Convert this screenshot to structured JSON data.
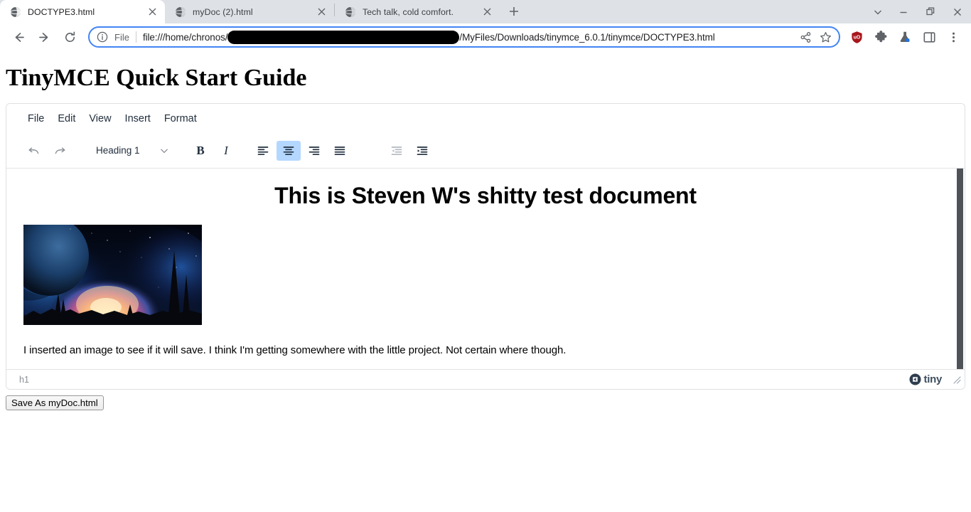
{
  "browser": {
    "tabs": [
      {
        "title": "DOCTYPE3.html",
        "active": true,
        "favicon": "globe-icon"
      },
      {
        "title": "myDoc (2).html",
        "active": false,
        "favicon": "globe-icon"
      },
      {
        "title": "Tech talk, cold comfort.",
        "active": false,
        "favicon": "globe-icon"
      }
    ],
    "new_tab_label": "+",
    "window_controls": {
      "tab_search": "tab-search-icon",
      "minimize": "minimize-icon",
      "maximize": "restore-icon",
      "close": "close-icon"
    },
    "nav": {
      "back": "back-arrow-icon",
      "forward": "forward-arrow-icon",
      "reload": "reload-icon"
    },
    "omnibox": {
      "info_icon": "info-circle-icon",
      "scheme_label": "File",
      "url_prefix": "file:///home/chronos/",
      "url_suffix": "/MyFiles/Downloads/tinymce_6.0.1/tinymce/DOCTYPE3.html",
      "redacted": true,
      "share_icon": "share-icon",
      "bookmark_icon": "star-icon"
    },
    "extensions": [
      {
        "name": "ublock-origin-icon",
        "color": "#a8161c"
      },
      {
        "name": "puzzle-extensions-icon",
        "color": "#5f6368"
      },
      {
        "name": "lab-flask-icon",
        "color": "#5f6368"
      },
      {
        "name": "side-panel-icon",
        "color": "#5f6368"
      }
    ],
    "menu_icon": "three-dot-menu-icon",
    "accent": "#4285f4",
    "tabstrip_bg": "#dee1e6"
  },
  "page": {
    "title": "TinyMCE Quick Start Guide"
  },
  "editor": {
    "menubar": [
      {
        "label": "File"
      },
      {
        "label": "Edit"
      },
      {
        "label": "View"
      },
      {
        "label": "Insert"
      },
      {
        "label": "Format"
      }
    ],
    "toolbar": {
      "undo": "undo-icon",
      "redo": "redo-icon",
      "format_select": {
        "value": "Heading 1",
        "chevron": "chevron-down-icon"
      },
      "bold": "B",
      "italic": "I",
      "align_left": "align-left-icon",
      "align_center": "align-center-icon",
      "align_right": "align-right-icon",
      "align_justify": "align-justify-icon",
      "outdent": "outdent-icon",
      "indent": "indent-icon",
      "active_button": "align-center-icon",
      "disabled_button": "outdent-icon",
      "active_highlight": "#b4d7ff"
    },
    "content": {
      "heading": "This is Steven W's shitty test document",
      "image_alt": "space-nebula-planet-landscape-image",
      "paragraph": "I inserted an image to see if it will save.  I think I'm getting somewhere with the little project.  Not certain where though."
    },
    "statusbar": {
      "element_path": "h1",
      "branding": "tiny",
      "branding_icon": "tiny-logo-icon",
      "resize_handle": "resize-grip-icon"
    }
  },
  "save_button": {
    "label": "Save As myDoc.html"
  }
}
